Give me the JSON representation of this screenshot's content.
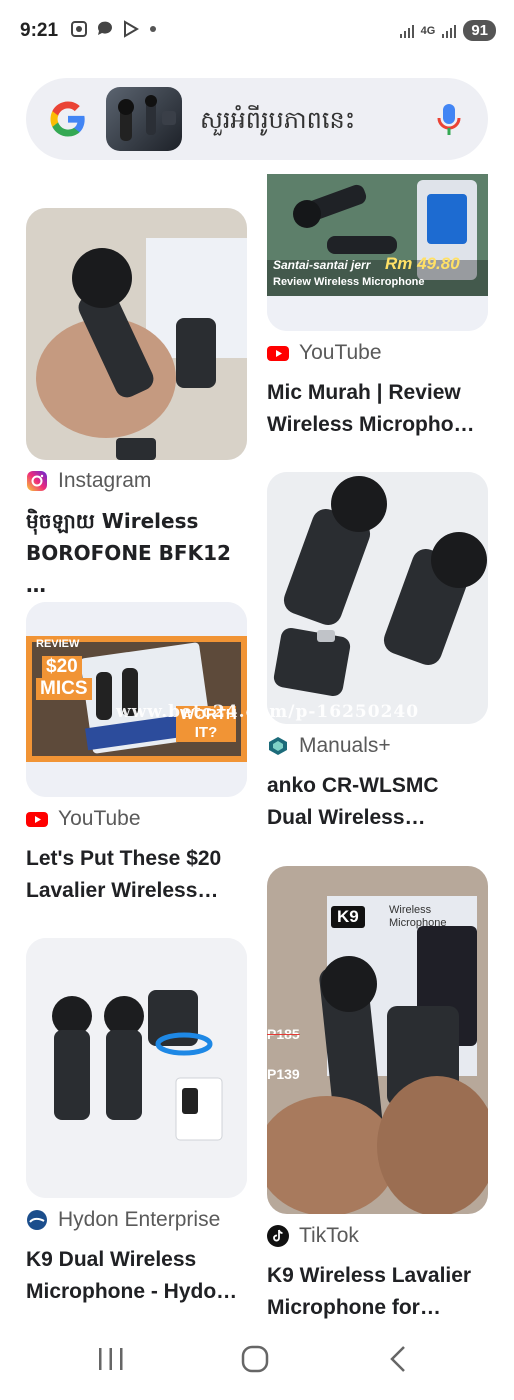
{
  "status": {
    "time": "9:21",
    "network": "4G",
    "battery": "91"
  },
  "search": {
    "query": "សួរអំពីរូបភាពនេះ"
  },
  "results": [
    {
      "source": "YouTube",
      "title": "Mic Murah | Review Wireless Micropho…",
      "thumb_caption_1": "Santai-santai jerr",
      "thumb_caption_2": "Rm 49.80",
      "thumb_caption_3": "Review Wireless Microphone"
    },
    {
      "source": "Instagram",
      "title": "ម៉ិចឡាយ Wireless BOROFONE BFK12 …"
    },
    {
      "source": "Manuals+",
      "title": "anko CR-WLSMC Dual Wireless…"
    },
    {
      "source": "YouTube",
      "title": "Let's Put These $20 Lavalier Wireless…",
      "thumb_caption_1": "REVIEW",
      "thumb_caption_2": "$20",
      "thumb_caption_3": "MICS",
      "thumb_caption_4": "WORTH IT?"
    },
    {
      "source": "Hydon Enterprise",
      "title": "K9 Dual Wireless Microphone - Hydo…"
    },
    {
      "source": "TikTok",
      "title": "K9 Wireless Lavalier Microphone for…",
      "thumb_caption_1": "K9",
      "thumb_caption_2": "Wireless Microphone",
      "thumb_caption_3": "P185",
      "thumb_caption_4": "P139"
    }
  ],
  "watermark": "www.betc24.com/p-16250240"
}
